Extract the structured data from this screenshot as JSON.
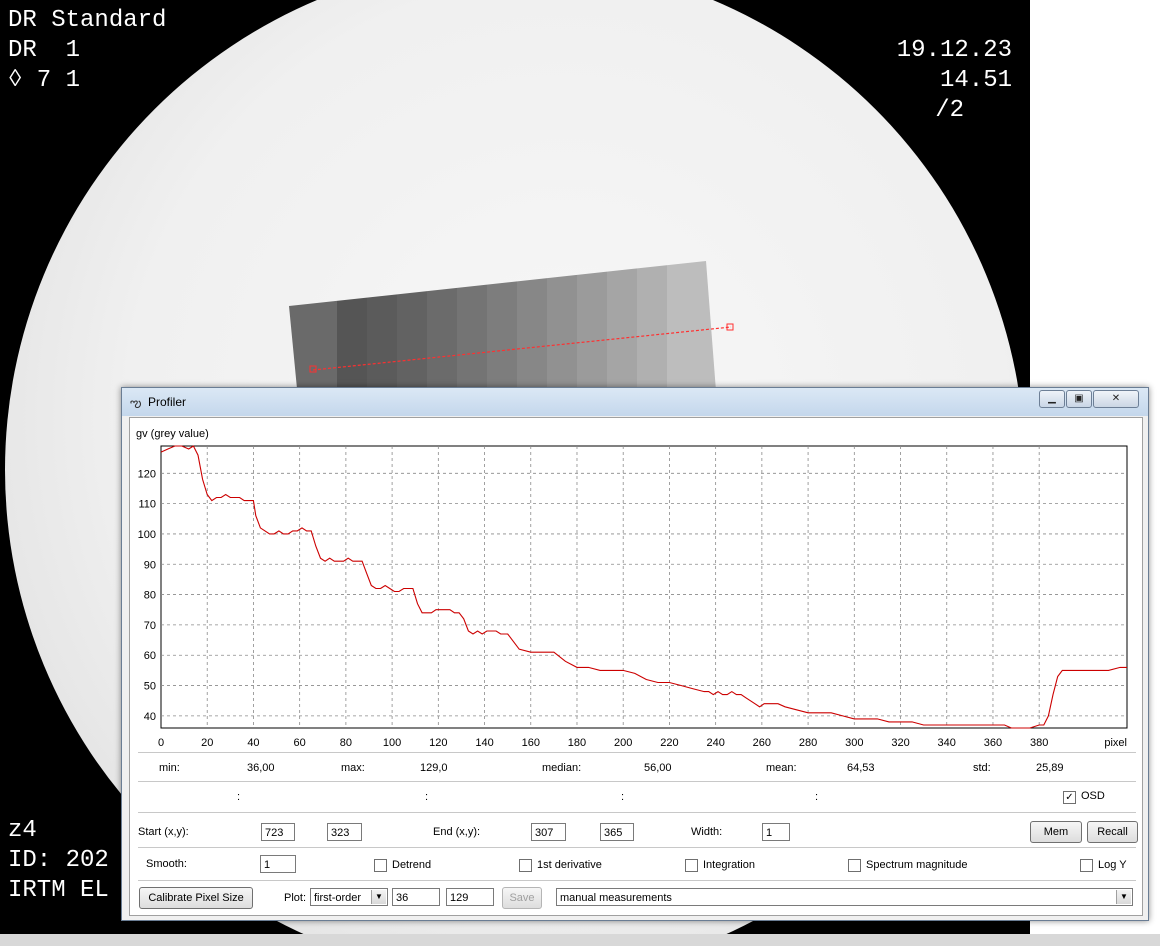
{
  "overlay": {
    "top_left": [
      "DR Standard",
      "DR  1",
      "◊ 7 1"
    ],
    "top_right": [
      "19.12.23",
      "14.51",
      "/2"
    ],
    "bottom_left": [
      "z4",
      "ID: 202",
      "IRTM EL"
    ]
  },
  "window": {
    "title": "Profiler",
    "icon": "profiler-app-icon",
    "controls": [
      "minimize-icon",
      "maximize-icon",
      "close-icon"
    ]
  },
  "chart_data": {
    "type": "line",
    "ylabel": "gv (grey value)",
    "xlabel": "pixel",
    "xlim": [
      0,
      418
    ],
    "ylim": [
      36,
      129
    ],
    "x_ticks": [
      "0",
      "20",
      "40",
      "60",
      "80",
      "100",
      "120",
      "140",
      "160",
      "180",
      "200",
      "220",
      "240",
      "260",
      "280",
      "300",
      "320",
      "340",
      "360",
      "380"
    ],
    "y_ticks": [
      "40",
      "50",
      "60",
      "70",
      "80",
      "90",
      "100",
      "110",
      "120"
    ],
    "grid": true,
    "line_color": "#cc0000",
    "series": [
      {
        "x": [
          0,
          3,
          6,
          9,
          12,
          14,
          16,
          18,
          20,
          22,
          24,
          26,
          28,
          30,
          32,
          34,
          36,
          38,
          40,
          41,
          43,
          45,
          47,
          49,
          51,
          53,
          55,
          57,
          59,
          61,
          63,
          65,
          67,
          69,
          71,
          73,
          75,
          77,
          79,
          81,
          83,
          85,
          87,
          89,
          91,
          93,
          95,
          97,
          99,
          101,
          103,
          105,
          107,
          109,
          111,
          113,
          115,
          117,
          119,
          121,
          123,
          125,
          127,
          129,
          131,
          133,
          135,
          137,
          139,
          141,
          143,
          145,
          147,
          150,
          155,
          160,
          163,
          166,
          168,
          170,
          175,
          180,
          185,
          190,
          192,
          194,
          196,
          198,
          200,
          205,
          210,
          215,
          218,
          220,
          225,
          230,
          235,
          237,
          239,
          241,
          243,
          245,
          247,
          249,
          251,
          253,
          255,
          257,
          259,
          261,
          263,
          265,
          267,
          270,
          275,
          280,
          283,
          285,
          290,
          295,
          300,
          305,
          310,
          315,
          320,
          325,
          330,
          335,
          340,
          345,
          350,
          355,
          360,
          363,
          365,
          368,
          372,
          376,
          380,
          382,
          384,
          386,
          388,
          390,
          392,
          394,
          396,
          400,
          405,
          410,
          415,
          418
        ],
        "values": [
          127,
          128,
          129,
          129,
          128,
          129,
          126,
          118,
          113,
          111,
          112,
          112,
          113,
          112,
          112,
          112,
          111,
          111,
          111,
          106,
          102,
          101,
          100,
          100,
          101,
          100,
          100,
          101,
          101,
          102,
          101,
          101,
          96,
          92,
          91,
          92,
          91,
          91,
          91,
          92,
          91,
          91,
          91,
          87,
          83,
          82,
          82,
          83,
          82,
          81,
          81,
          82,
          82,
          82,
          77,
          74,
          74,
          74,
          75,
          75,
          75,
          75,
          74,
          74,
          72,
          68,
          67,
          68,
          67,
          68,
          68,
          68,
          67,
          67,
          62,
          61,
          61,
          61,
          61,
          61,
          58,
          56,
          56,
          55,
          55,
          55,
          55,
          55,
          55,
          54,
          52,
          51,
          51,
          51,
          50,
          49,
          48,
          48,
          47,
          48,
          47,
          47,
          48,
          47,
          47,
          46,
          45,
          44,
          43,
          44,
          44,
          44,
          44,
          43,
          42,
          41,
          41,
          41,
          41,
          40,
          39,
          39,
          39,
          38,
          38,
          38,
          37,
          37,
          37,
          37,
          37,
          37,
          37,
          37,
          37,
          36,
          36,
          36,
          37,
          37,
          40,
          47,
          53,
          55,
          55,
          55,
          55,
          55,
          55,
          55,
          56,
          56
        ]
      }
    ]
  },
  "stats": [
    {
      "label": "min:",
      "value": "36,00"
    },
    {
      "label": "max:",
      "value": "129,0"
    },
    {
      "label": "median:",
      "value": "56,00"
    },
    {
      "label": "mean:",
      "value": "64,53"
    },
    {
      "label": "std:",
      "value": "25,89"
    }
  ],
  "osd_row": {
    "colons": [
      ":",
      ":",
      ":",
      ":"
    ],
    "osd_label": "OSD",
    "osd_checked": true
  },
  "coords": {
    "start_label": "Start (x,y):",
    "start_x": "723",
    "start_y": "323",
    "end_label": "End (x,y):",
    "end_x": "307",
    "end_y": "365",
    "width_label": "Width:",
    "width_value": "1",
    "mem_label": "Mem",
    "recall_label": "Recall"
  },
  "options": {
    "smooth_label": "Smooth:",
    "smooth_value": "1",
    "detrend_label": "Detrend",
    "derivative_label": "1st derivative",
    "integration_label": "Integration",
    "spectrum_label": "Spectrum magnitude",
    "logy_label": "Log Y"
  },
  "bottom_bar": {
    "calibrate_label": "Calibrate Pixel Size",
    "plot_label": "Plot:",
    "plot_select": "first-order",
    "plot_min": "36",
    "plot_max": "129",
    "save_label": "Save",
    "measure_select": "manual measurements"
  }
}
